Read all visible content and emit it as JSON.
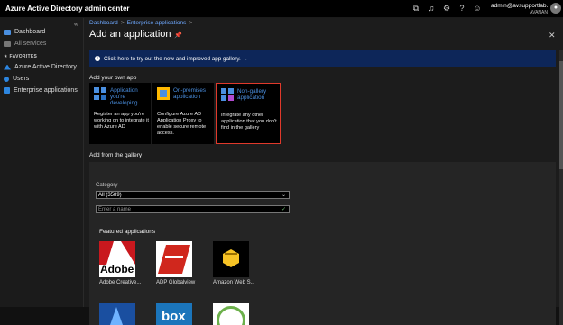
{
  "header": {
    "app_title": "Azure Active Directory admin center",
    "user_email": "admin@avsupportlab.o...",
    "tenant": "AVANAN",
    "icons": [
      "portal-icon",
      "bell-icon",
      "gear-icon",
      "help-icon",
      "feedback-icon"
    ]
  },
  "sidebar": {
    "items": [
      {
        "label": "Dashboard",
        "icon": "dashboard-icon",
        "color": "#4a8fe0"
      },
      {
        "label": "All services",
        "icon": "all-services-icon",
        "color": "#777777"
      },
      {
        "label": "Azure Active Directory",
        "icon": "aad-icon",
        "color": "#2d86e0"
      },
      {
        "label": "Users",
        "icon": "users-icon",
        "color": "#2d86e0"
      },
      {
        "label": "Enterprise applications",
        "icon": "enterprise-apps-icon",
        "color": "#2d86e0"
      }
    ],
    "favorites_label": "FAVORITES"
  },
  "breadcrumb": {
    "items": [
      "Dashboard",
      "Enterprise applications"
    ],
    "separator": ">"
  },
  "page": {
    "title": "Add an application"
  },
  "banner": {
    "text": "Click here to try out the new and improved app gallery. →"
  },
  "own_app": {
    "heading": "Add your own app",
    "cards": [
      {
        "title": "Application you're developing",
        "desc": "Register an app you're working on to integrate it with Azure AD",
        "icon": "app-grid-icon",
        "selected": false
      },
      {
        "title": "On-premises application",
        "desc": "Configure Azure AD Application Proxy to enable secure remote access.",
        "icon": "on-premises-icon",
        "selected": false
      },
      {
        "title": "Non-gallery application",
        "desc": "Integrate any other application that you don't find in the gallery",
        "icon": "non-gallery-icon",
        "selected": true
      }
    ]
  },
  "gallery": {
    "heading": "Add from the gallery",
    "category_label": "Category",
    "category_value": "All (3589)",
    "name_placeholder": "Enter a name",
    "featured_label": "Featured applications",
    "apps": [
      {
        "name": "Adobe Creative...",
        "logo": "adobe-logo",
        "logo_text": "Adobe",
        "bg": "#ffffff"
      },
      {
        "name": "ADP Globalview",
        "logo": "adp-logo",
        "bg": "#ffffff"
      },
      {
        "name": "Amazon Web S...",
        "logo": "aws-logo",
        "bg": "#000000"
      },
      {
        "name": "",
        "logo": "atlassian-logo",
        "bg": "#1a4fa0"
      },
      {
        "name": "",
        "logo": "box-logo",
        "logo_text": "box",
        "bg": "#1b75bb"
      },
      {
        "name": "",
        "logo": "partial-circle-logo",
        "bg": "#ffffff"
      }
    ]
  }
}
